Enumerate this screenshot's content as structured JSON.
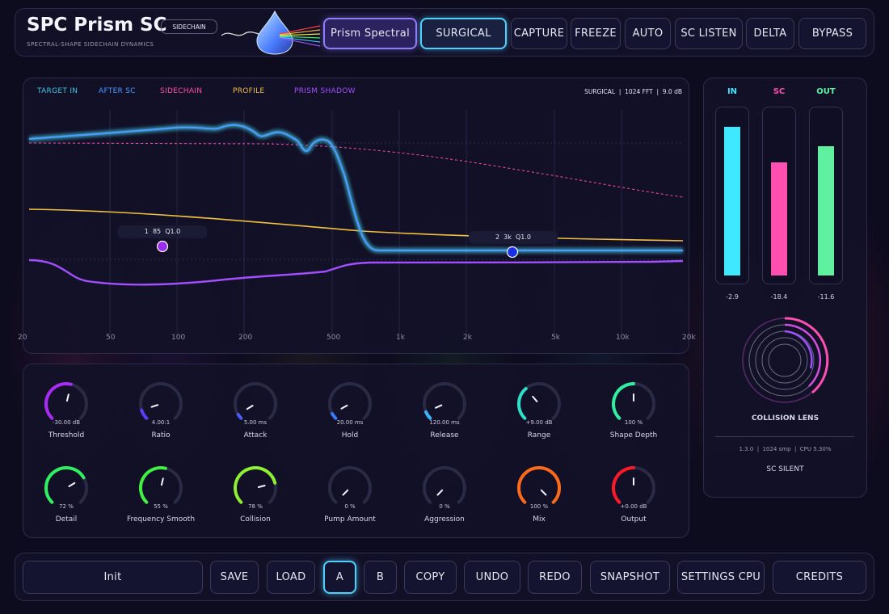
{
  "header": {
    "title": "SPC Prism SC",
    "subtitle": "SPECTRAL-SHAPE SIDECHAIN DYNAMICS",
    "badge": "SIDECHAIN",
    "buttons": [
      "Prism Spectral",
      "SURGICAL",
      "CAPTURE",
      "FREEZE",
      "AUTO",
      "SC LISTEN",
      "DELTA",
      "BYPASS"
    ]
  },
  "spectrum": {
    "legend": [
      {
        "label": "TARGET IN",
        "color": "#3fc6e0"
      },
      {
        "label": "AFTER SC",
        "color": "#4a9cff"
      },
      {
        "label": "SIDECHAIN",
        "color": "#ff4fa8"
      },
      {
        "label": "PROFILE",
        "color": "#f2c040"
      },
      {
        "label": "PRISM SHADOW",
        "color": "#a14fff"
      }
    ],
    "status": "SURGICAL  |  1024 FFT  |  9.0 dB",
    "freq_ticks": [
      "20",
      "50",
      "100",
      "200",
      "500",
      "1k",
      "2k",
      "5k",
      "10k",
      "20k"
    ],
    "nodes": [
      {
        "label": "1  85  Q1.0",
        "color": "#9b2cf0"
      },
      {
        "label": "2  3k  Q1.0",
        "color": "#1a2fe8"
      }
    ]
  },
  "knobs": [
    {
      "name": "Threshold",
      "value": "-30.00 dB",
      "fraction": 0.55,
      "color": "#a82cf5"
    },
    {
      "name": "Ratio",
      "value": "4.00:1",
      "fraction": 0.1,
      "color": "#5a3cff"
    },
    {
      "name": "Attack",
      "value": "5.00 ms",
      "fraction": 0.05,
      "color": "#4a5cff"
    },
    {
      "name": "Hold",
      "value": "20.00 ms",
      "fraction": 0.06,
      "color": "#3a7cff"
    },
    {
      "name": "Release",
      "value": "120.00 ms",
      "fraction": 0.08,
      "color": "#3ab4ff"
    },
    {
      "name": "Range",
      "value": "+9.00 dB",
      "fraction": 0.35,
      "color": "#2ee0c8"
    },
    {
      "name": "Shape Depth",
      "value": "100 %",
      "fraction": 0.5,
      "color": "#2ef0a0"
    },
    {
      "name": "Detail",
      "value": "72 %",
      "fraction": 0.72,
      "color": "#2ef060"
    },
    {
      "name": "Frequency Smooth",
      "value": "55 %",
      "fraction": 0.55,
      "color": "#40f040"
    },
    {
      "name": "Collision",
      "value": "78 %",
      "fraction": 0.78,
      "color": "#8ef030"
    },
    {
      "name": "Pump Amount",
      "value": "0 %",
      "fraction": 0.0,
      "color": "#a0a0a0"
    },
    {
      "name": "Aggression",
      "value": "0 %",
      "fraction": 0.0,
      "color": "#a0a0a0"
    },
    {
      "name": "Mix",
      "value": "100 %",
      "fraction": 1.0,
      "color": "#ff6a1a"
    },
    {
      "name": "Output",
      "value": "+0.00 dB",
      "fraction": 0.5,
      "color": "#ff1a2a"
    }
  ],
  "meters": [
    {
      "label": "IN",
      "value": "-2.9",
      "level": 0.92,
      "color": "#3fe8ff"
    },
    {
      "label": "SC",
      "value": "-18.4",
      "level": 0.7,
      "color": "#ff4fb0"
    },
    {
      "label": "OUT",
      "value": "-11.6",
      "level": 0.8,
      "color": "#5ff0a0"
    }
  ],
  "lens": {
    "title": "COLLISION LENS"
  },
  "info": {
    "line": "1.3.0  |  1024 smp  |  CPU 5.30%",
    "status": "SC SILENT"
  },
  "footer": {
    "preset": "Init",
    "buttons": [
      "SAVE",
      "LOAD",
      "A",
      "B",
      "COPY",
      "UNDO",
      "REDO",
      "SNAPSHOT",
      "SETTINGS CPU",
      "CREDITS"
    ]
  }
}
